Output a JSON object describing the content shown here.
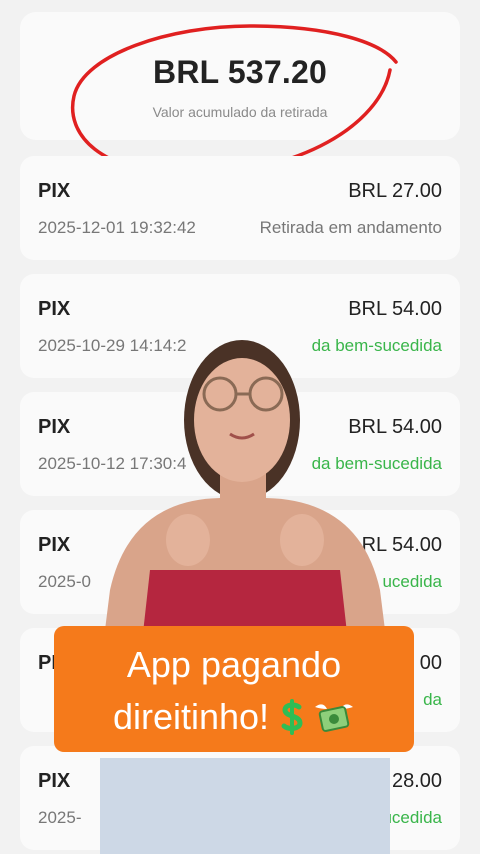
{
  "summary": {
    "amount": "BRL 537.20",
    "label": "Valor acumulado da retirada"
  },
  "transactions": [
    {
      "method": "PIX",
      "amount": "BRL 27.00",
      "date": "2025-12-01 19:32:42",
      "status": "Retirada em andamento"
    },
    {
      "method": "PIX",
      "amount": "BRL 54.00",
      "date": "2025-10-29 14:14:2",
      "status": "da bem-sucedida"
    },
    {
      "method": "PIX",
      "amount": "BRL 54.00",
      "date": "2025-10-12 17:30:4",
      "status": "da bem-sucedida"
    },
    {
      "method": "PIX",
      "amount": "RL 54.00",
      "date": "2025-0",
      "status": "ucedida"
    },
    {
      "method": "PI",
      "amount": "00",
      "date": "",
      "status": "da"
    },
    {
      "method": "PIX",
      "amount": "BRL 28.00",
      "date": "2025-",
      "status": "-sucedida"
    }
  ],
  "caption": {
    "line1": "App pagando",
    "line2": "direitinho!"
  },
  "icons": {
    "dollar": "heavy-dollar-sign-icon",
    "money": "money-with-wings-icon"
  },
  "colors": {
    "success": "#39b54a",
    "highlight": "#e02020",
    "caption_bg": "#f57a1b"
  }
}
